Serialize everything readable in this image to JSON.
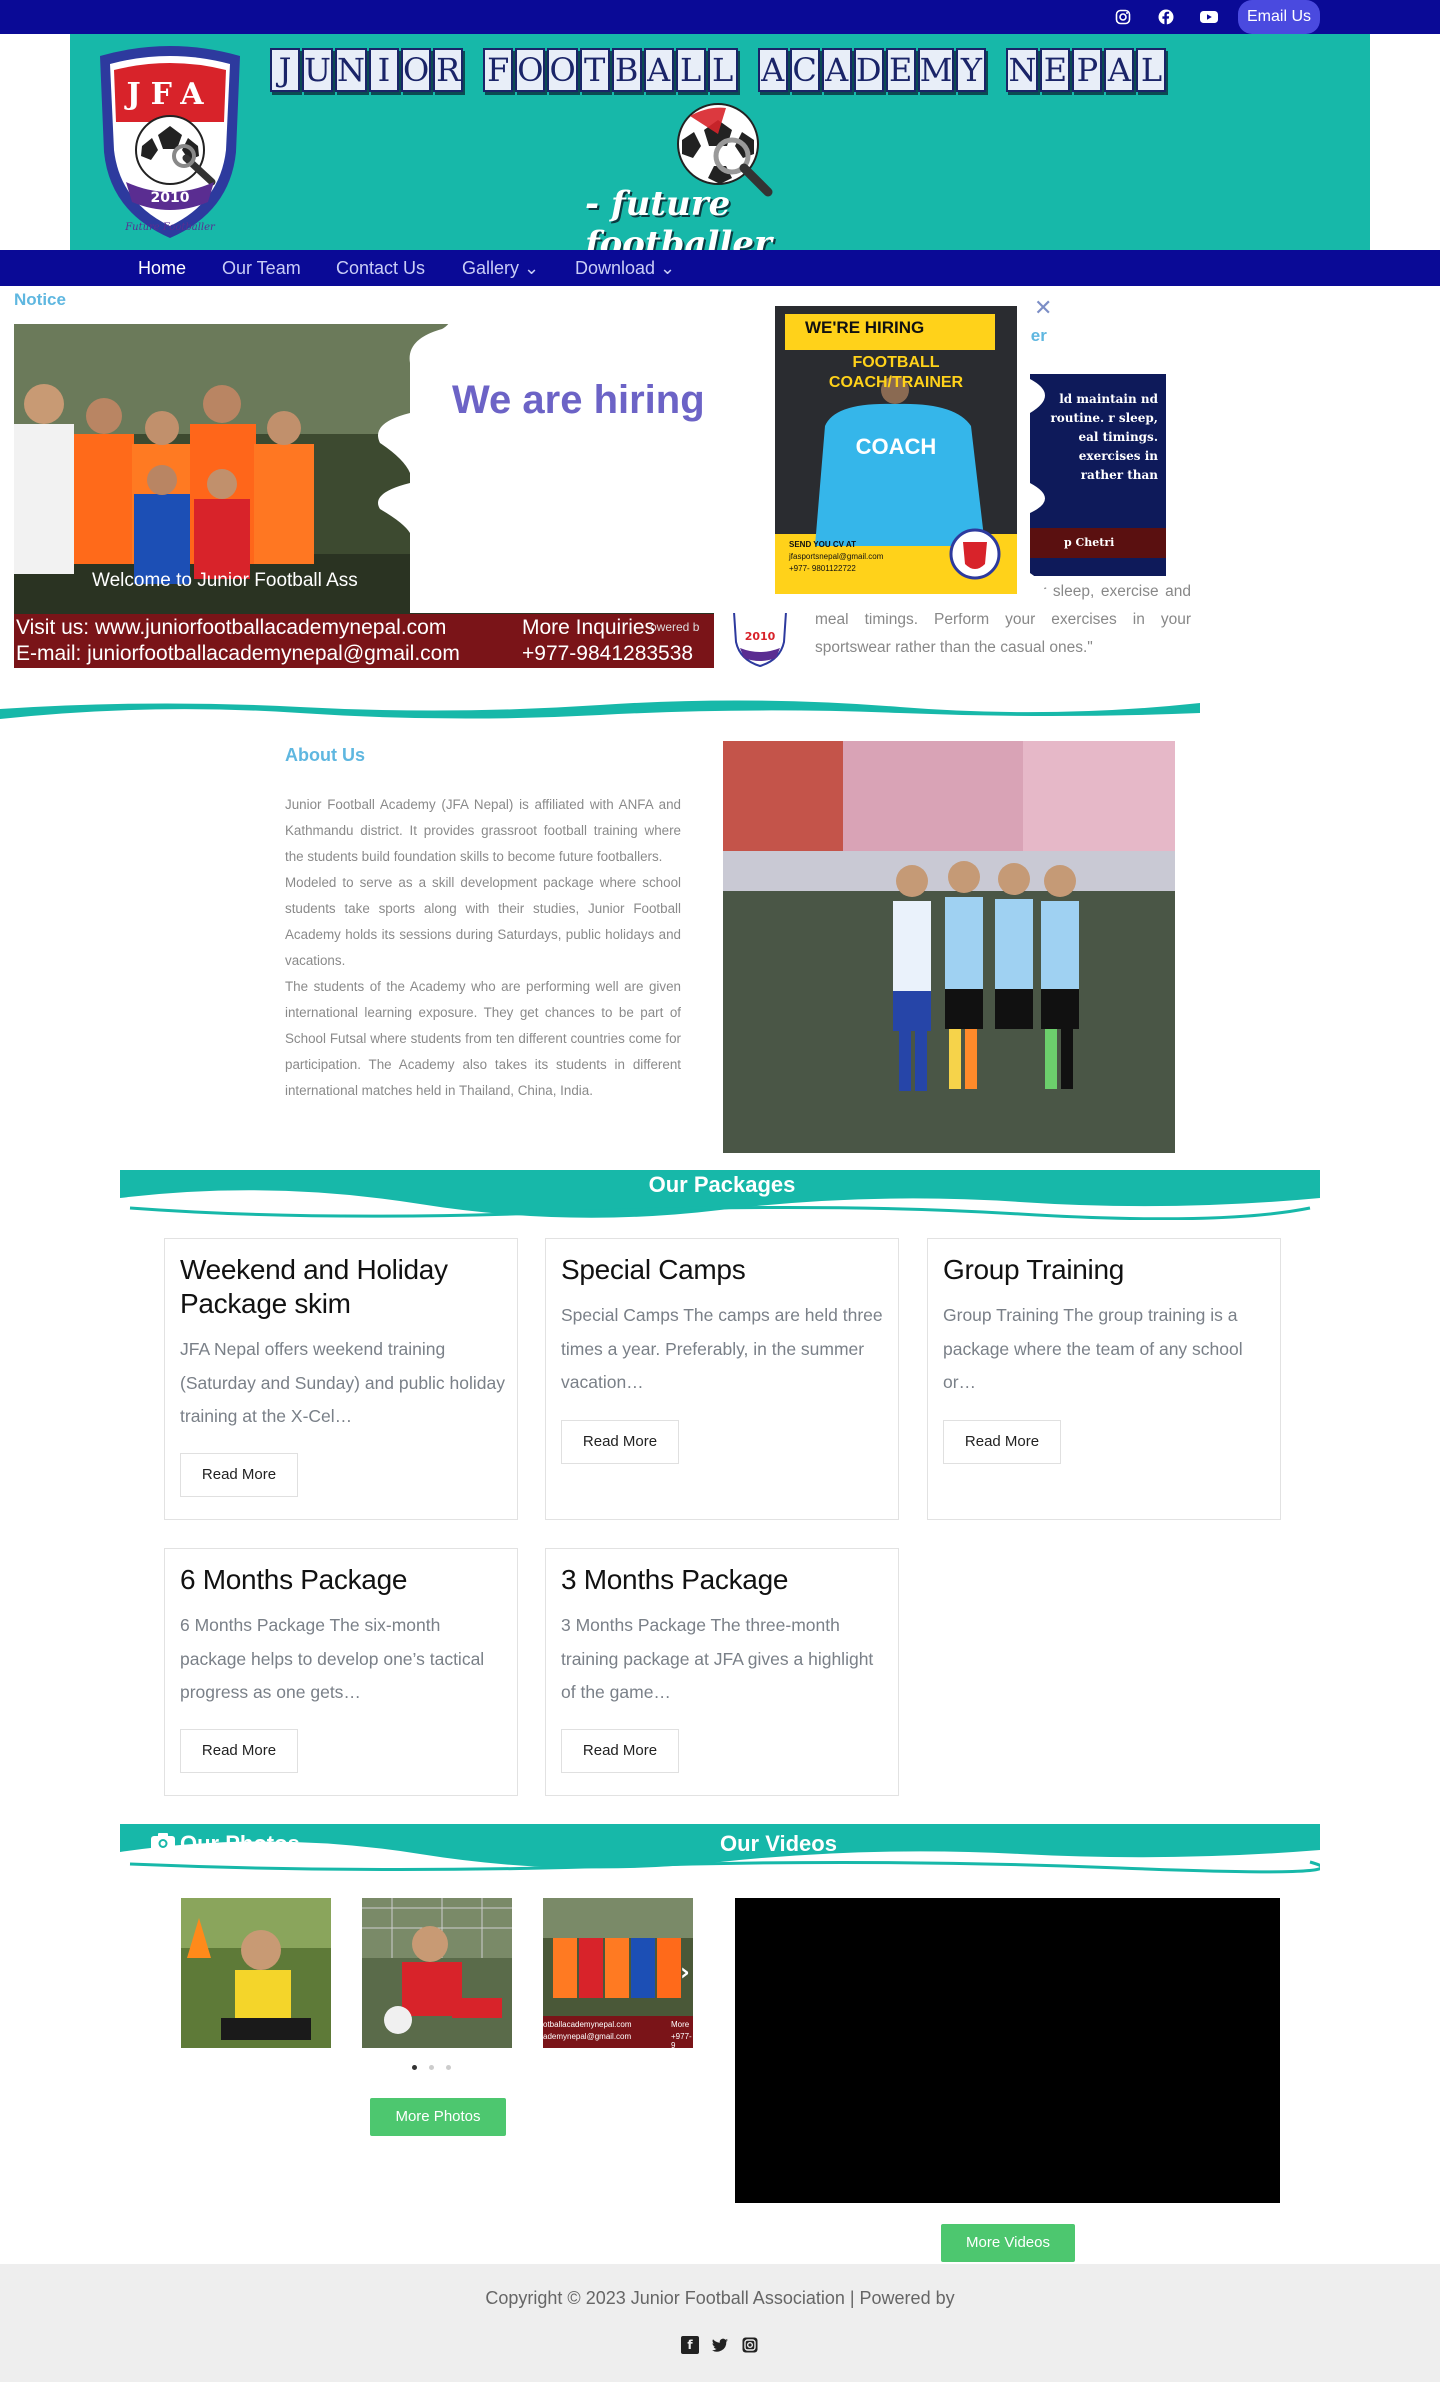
{
  "topbar": {
    "email_label": "Email Us",
    "social_icons": [
      "instagram-icon",
      "facebook-icon",
      "youtube-icon"
    ]
  },
  "header": {
    "banner_title_letters": [
      "J",
      "U",
      "N",
      "I",
      "O",
      "R",
      " ",
      "F",
      "O",
      "O",
      "T",
      "B",
      "A",
      "L",
      "L",
      " ",
      "A",
      "C",
      "A",
      "D",
      "E",
      "M",
      "Y",
      " ",
      "N",
      "E",
      "P",
      "A",
      "L"
    ],
    "tagline": "- future footballer",
    "crest_letters": "JFA",
    "crest_year": "2010",
    "crest_motto": "Future Footballer"
  },
  "nav": {
    "items": [
      {
        "label": "Home",
        "active": true
      },
      {
        "label": "Our Team"
      },
      {
        "label": "Contact Us"
      },
      {
        "label": "Gallery ⌄"
      },
      {
        "label": "Download ⌄"
      }
    ]
  },
  "notice": {
    "label": "Notice",
    "welcome": "Welcome to Junior Football Ass",
    "strip_line1": "Visit us: www.juniorfootballacademynepal.com",
    "strip_line2": "E-mail: juniorfootballacademynepal@gmail.com",
    "strip_more": "More Inquiries",
    "strip_phone": "+977-9841283538",
    "powered": "owered b"
  },
  "popup": {
    "title": "We are hiring",
    "close": "✕",
    "poster_badge": "WE'RE HIRING",
    "poster_role_1": "FOOTBALL",
    "poster_role_2": "COACH/TRAINER",
    "poster_shirt": "COACH",
    "poster_send": "SEND YOU CV AT",
    "poster_email": "jfasportsnepal@gmail.com",
    "poster_phone": "+977- 9801122722"
  },
  "founder": {
    "title_partial": "nder",
    "card_text": "ld maintain nd routine. r sleep, eal timings. exercises in rather than",
    "card_sign": "p Chetri",
    "quote": "ule and routine. Maintain regular sleep, exercise and meal timings. Perform your exercises in your sportswear rather than the casual ones.\""
  },
  "about": {
    "title": "About Us",
    "paragraphs": [
      "Junior Football Academy (JFA Nepal) is affiliated with ANFA and Kathmandu district. It provides grassroot football training where the students build foundation skills to become future footballers.",
      "Modeled to serve as a skill development package where school students take sports along with their studies, Junior Football Academy holds its sessions during Saturdays, public holidays and vacations.",
      "The students of the Academy who are performing well are given international learning exposure. They get chances to be part of School Futsal where students from ten different countries come for participation. The Academy also takes its students in different international matches held in Thailand, China, India."
    ]
  },
  "packages": {
    "heading": "Our Packages",
    "cards": [
      {
        "title": "Weekend and Holiday Package skim",
        "text": "JFA Nepal offers weekend training (Saturday and Sunday) and public holiday training at the X-Cel…",
        "button": "Read More"
      },
      {
        "title": "Special Camps",
        "text": "Special Camps The camps are held three times a year. Preferably, in the summer vacation…",
        "button": "Read More"
      },
      {
        "title": "Group Training",
        "text": "Group Training The group training is a package where the team of any school or…",
        "button": "Read More"
      },
      {
        "title": "6 Months Package",
        "text": "6 Months Package The six-month package helps to develop one’s tactical progress as one gets…",
        "button": "Read More"
      },
      {
        "title": "3 Months Package",
        "text": "3 Months Package The three-month training package at JFA gives a highlight of the game…",
        "button": "Read More"
      }
    ]
  },
  "media": {
    "photos_heading": "Our Photos",
    "videos_heading": "Our Videos",
    "more_photos": "More Photos",
    "more_videos": "More Videos",
    "carousel_next": "›",
    "thumb3_caption_1": "otballacademynepal.com",
    "thumb3_caption_2": "ademynepal@gmail.com",
    "thumb3_more": "More",
    "thumb3_phone": "+977-9"
  },
  "footer": {
    "copyright": "Copyright © 2023 Junior Football Association | Powered by",
    "icons": [
      "facebook-icon",
      "twitter-icon",
      "instagram-icon"
    ]
  },
  "colors": {
    "navy": "#0a0a96",
    "teal": "#17b8a9",
    "accent_blue": "#5fb7e0",
    "green_button": "#4dc76f",
    "popup_title": "#6c63c6"
  }
}
